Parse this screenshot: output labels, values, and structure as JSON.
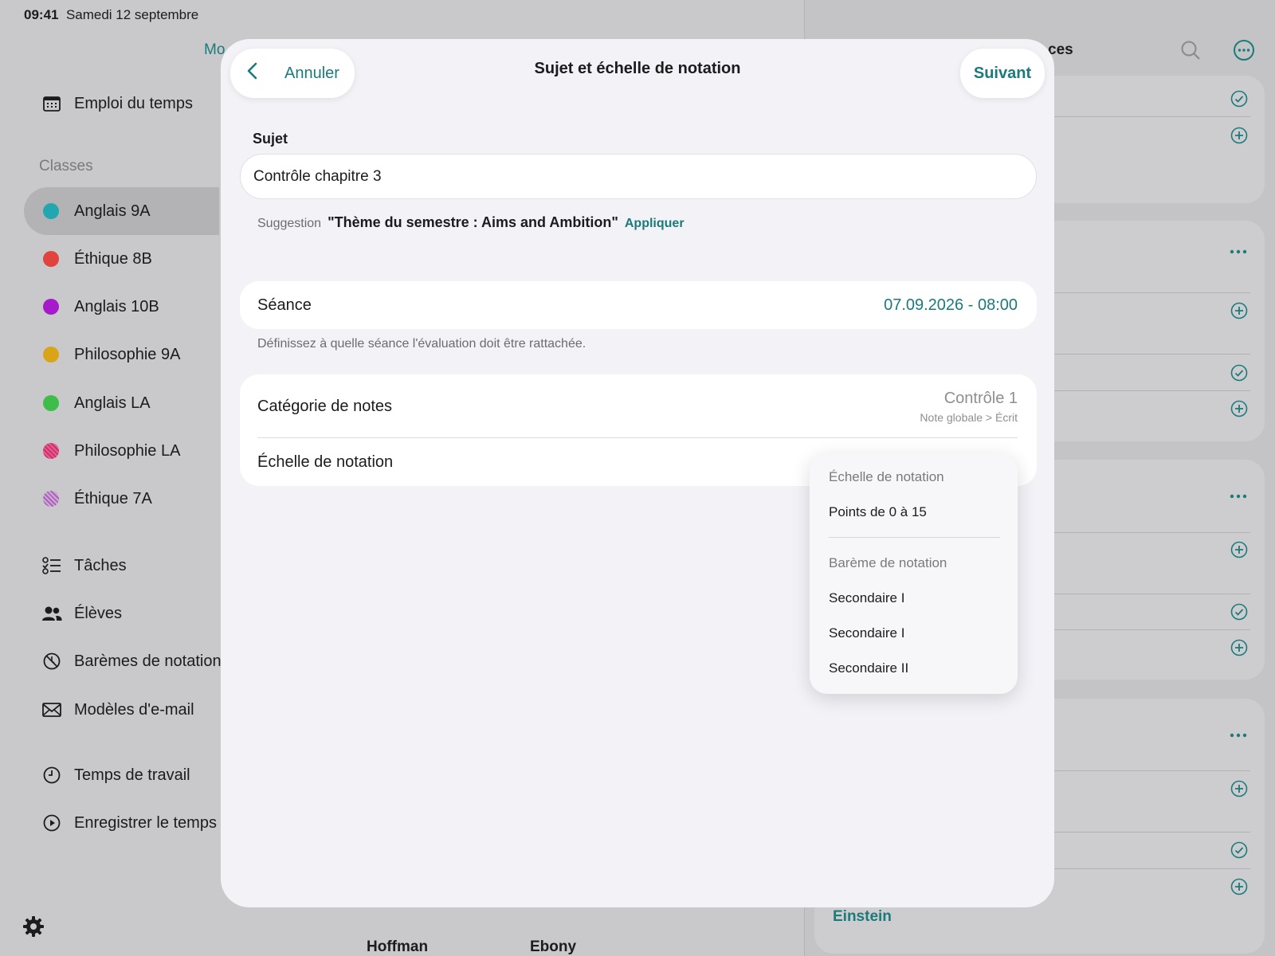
{
  "status": {
    "time": "09:41",
    "date": "Samedi 12 septembre"
  },
  "sidebar": {
    "top_partial": "Mo",
    "schedule": "Emploi du temps",
    "section": "Classes",
    "classes": [
      {
        "label": "Anglais 9A",
        "color": "#22a7b0"
      },
      {
        "label": "Éthique 8B",
        "color": "#e0443c"
      },
      {
        "label": "Anglais 10B",
        "color": "#a51bcc"
      },
      {
        "label": "Philosophie 9A",
        "color": "#d9a516"
      },
      {
        "label": "Anglais LA",
        "color": "#3ebd4a"
      },
      {
        "label": "Philosophie LA",
        "color": "#d12e6e"
      },
      {
        "label": "Éthique 7A",
        "color": "#a765b5"
      }
    ],
    "tools": [
      {
        "label": "Tâches",
        "icon": "tasks-icon"
      },
      {
        "label": "Élèves",
        "icon": "students-icon"
      },
      {
        "label": "Barèmes de notation",
        "icon": "grading-scales-icon"
      },
      {
        "label": "Modèles d'e-mail",
        "icon": "mail-icon"
      }
    ],
    "time": [
      {
        "label": "Temps de travail",
        "icon": "clock-icon"
      },
      {
        "label": "Enregistrer le temps",
        "icon": "play-icon"
      }
    ]
  },
  "background": {
    "panel_title_partial": "ces",
    "einstein": "Einstein",
    "names": [
      "Hoffman",
      "Ebony"
    ]
  },
  "modal": {
    "cancel": "Annuler",
    "title": "Sujet et échelle de notation",
    "next": "Suivant",
    "subject_label": "Sujet",
    "subject_value": "Contrôle chapitre 3",
    "suggestion_key": "Suggestion",
    "suggestion_value": "\"Thème du semestre : Aims and Ambition\"",
    "suggestion_apply": "Appliquer",
    "session_label": "Séance",
    "session_value": "07.09.2026 - 08:00",
    "session_hint": "Définissez à quelle séance l'évaluation doit être rattachée.",
    "category_label": "Catégorie de notes",
    "category_value": "Contrôle 1",
    "category_sub": "Note globale > Écrit",
    "scale_label": "Échelle de notation"
  },
  "menu": {
    "scale_header": "Échelle de notation",
    "scale_option": "Points de 0 à 15",
    "bareme_header": "Barème de notation",
    "bareme_options": [
      "Secondaire I",
      "Secondaire I",
      "Secondaire II"
    ]
  },
  "colors": {
    "accent": "#1b7a7a"
  }
}
